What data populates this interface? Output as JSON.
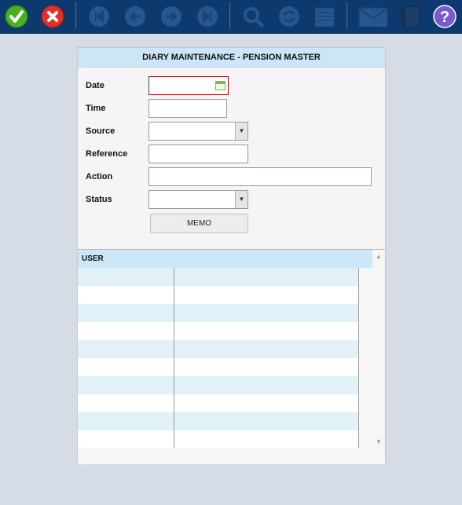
{
  "toolbar": {
    "buttons": [
      {
        "icon": "check-icon",
        "label": "Save"
      },
      {
        "icon": "close-icon",
        "label": "Cancel"
      },
      {
        "icon": "first-record-icon",
        "label": "First"
      },
      {
        "icon": "previous-record-icon",
        "label": "Previous"
      },
      {
        "icon": "next-record-icon",
        "label": "Next"
      },
      {
        "icon": "last-record-icon",
        "label": "Last"
      },
      {
        "icon": "search-icon",
        "label": "Search"
      },
      {
        "icon": "refresh-icon",
        "label": "Refresh"
      },
      {
        "icon": "notepad-icon",
        "label": "Notes"
      },
      {
        "icon": "mail-icon",
        "label": "Mail"
      },
      {
        "icon": "book-icon",
        "label": "Book"
      },
      {
        "icon": "help-icon",
        "label": "Help"
      }
    ]
  },
  "form": {
    "title": "DIARY MAINTENANCE - PENSION MASTER",
    "fields": {
      "date": {
        "label": "Date",
        "value": ""
      },
      "time": {
        "label": "Time",
        "value": ""
      },
      "source": {
        "label": "Source",
        "value": ""
      },
      "reference": {
        "label": "Reference",
        "value": ""
      },
      "action": {
        "label": "Action",
        "value": ""
      },
      "status": {
        "label": "Status",
        "value": ""
      }
    },
    "memo_label": "MEMO"
  },
  "grid": {
    "columns": [
      "USER"
    ],
    "rows": []
  },
  "colors": {
    "toolbar_bg": "#0d3a6e",
    "panel_header_bg": "#cce6f7",
    "required_border": "#b31c1c",
    "row_alt_bg": "#e1f1f8"
  }
}
